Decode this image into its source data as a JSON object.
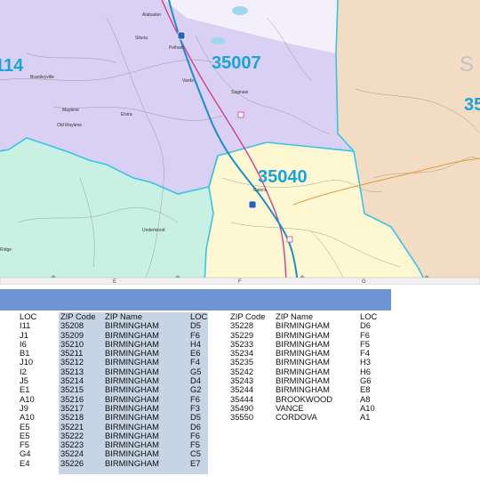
{
  "map": {
    "zip_labels": [
      "114",
      "35007",
      "35040",
      "S",
      "35"
    ],
    "places": [
      "Alabaster",
      "Siluria",
      "Saginaw",
      "Brantleyville",
      "Maylene",
      "Old Maylene",
      "Elvira",
      "Varde",
      "Pelham",
      "Calera",
      "Underwood",
      "Ridge"
    ],
    "grid_letters": [
      "E",
      "F",
      "G"
    ],
    "colors": {
      "purple_zone": "#d9d0f3",
      "green_zone": "#c9f1e3",
      "yellow_zone": "#fdf8d2",
      "peach_zone": "#f3dcc4",
      "boundary": "#39c3e5",
      "interstate": "#1c8fc7",
      "highway": "#cf3f8f"
    }
  },
  "table": {
    "headers": {
      "loc": "LOC",
      "zip": "ZIP Code",
      "name": "ZIP Name"
    },
    "col1_loc": [
      "I11",
      "J1",
      "I6",
      "B1",
      "J10",
      "I2",
      "J5",
      "E1",
      "A10",
      "J9",
      "A10",
      "E5",
      "E5",
      "F5",
      "G4",
      "E4"
    ],
    "col2_zip": [
      "35208",
      "35209",
      "35210",
      "35211",
      "35212",
      "35213",
      "35214",
      "35215",
      "35216",
      "35217",
      "35218",
      "35221",
      "35222",
      "35223",
      "35224",
      "35226"
    ],
    "col2_name": [
      "BIRMINGHAM",
      "BIRMINGHAM",
      "BIRMINGHAM",
      "BIRMINGHAM",
      "BIRMINGHAM",
      "BIRMINGHAM",
      "BIRMINGHAM",
      "BIRMINGHAM",
      "BIRMINGHAM",
      "BIRMINGHAM",
      "BIRMINGHAM",
      "BIRMINGHAM",
      "BIRMINGHAM",
      "BIRMINGHAM",
      "BIRMINGHAM",
      "BIRMINGHAM"
    ],
    "col2_loc": [
      "D5",
      "F6",
      "H4",
      "E6",
      "F4",
      "G5",
      "D4",
      "G2",
      "F6",
      "F3",
      "D5",
      "D6",
      "F6",
      "F5",
      "C5",
      "E7"
    ],
    "col3_zip": [
      "35228",
      "35229",
      "35233",
      "35234",
      "35235",
      "35242",
      "35243",
      "35244",
      "35444",
      "35490",
      "35550"
    ],
    "col3_name": [
      "BIRMINGHAM",
      "BIRMINGHAM",
      "BIRMINGHAM",
      "BIRMINGHAM",
      "BIRMINGHAM",
      "BIRMINGHAM",
      "BIRMINGHAM",
      "BIRMINGHAM",
      "BROOKWOOD",
      "VANCE",
      "CORDOVA"
    ],
    "col3_loc": [
      "D6",
      "F6",
      "F5",
      "F4",
      "H3",
      "H6",
      "G6",
      "E8",
      "A8",
      "A10",
      "A1"
    ],
    "colors": {
      "header_bar": "#6f95d6",
      "shade": "#c6d4e3"
    }
  }
}
